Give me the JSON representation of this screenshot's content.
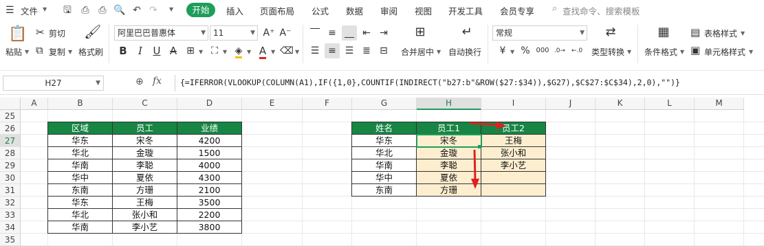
{
  "menu": {
    "file": "文件",
    "tabs": [
      "开始",
      "插入",
      "页面布局",
      "公式",
      "数据",
      "审阅",
      "视图",
      "开发工具",
      "会员专享"
    ],
    "search_placeholder": "查找命令、搜索模板"
  },
  "ribbon": {
    "paste": "粘贴",
    "cut": "剪切",
    "copy": "复制",
    "format_painter": "格式刷",
    "font_name": "阿里巴巴普惠体",
    "font_size": "11",
    "merge_center": "合并居中",
    "wrap_text": "自动换行",
    "number_format": "常规",
    "type_convert": "类型转换",
    "conditional_format": "条件格式",
    "table_style": "表格样式",
    "cell_style": "单元格样式"
  },
  "formula_bar": {
    "name_box": "H27",
    "fx": "fx",
    "formula": "{=IFERROR(VLOOKUP(COLUMN(A1),IF({1,0},COUNTIF(INDIRECT(\"b27:b\"&ROW($27:$34)),$G27),$C$27:$C$34),2,0),\"\")}"
  },
  "grid": {
    "columns": [
      "A",
      "B",
      "C",
      "D",
      "E",
      "F",
      "G",
      "H",
      "I",
      "J",
      "K",
      "L",
      "M"
    ],
    "rows": [
      "25",
      "26",
      "27",
      "28",
      "29",
      "30",
      "31",
      "32",
      "33",
      "34",
      "35"
    ],
    "selected_cell": "H27"
  },
  "table1": {
    "headers": [
      "区域",
      "员工",
      "业绩"
    ],
    "rows": [
      [
        "华东",
        "宋冬",
        "4200"
      ],
      [
        "华北",
        "金璇",
        "1500"
      ],
      [
        "华南",
        "李聪",
        "4000"
      ],
      [
        "华中",
        "夏依",
        "4300"
      ],
      [
        "东南",
        "方珊",
        "2100"
      ],
      [
        "华东",
        "王梅",
        "3500"
      ],
      [
        "华北",
        "张小和",
        "2200"
      ],
      [
        "华南",
        "李小艺",
        "3800"
      ]
    ]
  },
  "table2": {
    "headers": [
      "姓名",
      "员工1",
      "员工2"
    ],
    "rows": [
      [
        "华东",
        "宋冬",
        "王梅"
      ],
      [
        "华北",
        "金璇",
        "张小和"
      ],
      [
        "华南",
        "李聪",
        "李小艺"
      ],
      [
        "华中",
        "夏依",
        ""
      ],
      [
        "东南",
        "方珊",
        ""
      ]
    ]
  },
  "colors": {
    "accent": "#1e9d5b",
    "header_fill": "#178544",
    "result_fill": "#fdeecf",
    "arrow": "#e02020"
  }
}
